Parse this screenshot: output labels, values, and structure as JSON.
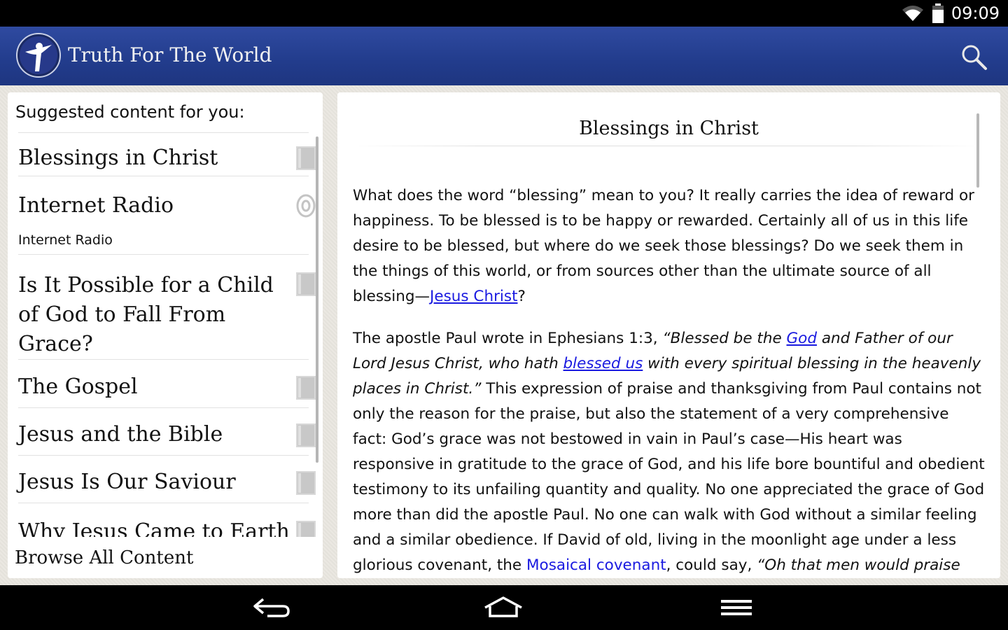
{
  "status_bar": {
    "time": "09:09",
    "icons": [
      "wifi-icon",
      "battery-icon"
    ]
  },
  "app_bar": {
    "title": "Truth For The World",
    "logo": "truth-for-the-world-logo",
    "search_icon": "search-icon",
    "color": "#223c8c"
  },
  "sidebar": {
    "header": "Suggested content for you:",
    "items": [
      {
        "title": "Blessings in Christ",
        "icon": "book-icon"
      },
      {
        "title": "Internet Radio",
        "subtitle": "Internet Radio",
        "icon": "radio-icon"
      },
      {
        "title": "Is It Possible for a Child of God to Fall From Grace?",
        "icon": "book-icon"
      },
      {
        "title": "The Gospel",
        "icon": "book-icon"
      },
      {
        "title": "Jesus and the Bible",
        "icon": "book-icon"
      },
      {
        "title": "Jesus Is Our Saviour",
        "icon": "book-icon"
      },
      {
        "title": "Why Jesus Came to Earth",
        "icon": "book-icon"
      }
    ],
    "browse_all": "Browse All Content"
  },
  "article": {
    "title": "Blessings in Christ",
    "p1": {
      "text": "What does the word “blessing” mean to you? It really carries the idea of reward or happiness. To be blessed is to be happy or rewarded. Certainly all of us in this life desire to be blessed, but where do we seek those blessings? Do we seek them in the things of this world, or from sources other than the ultimate source of all blessing—",
      "link": "Jesus Christ",
      "end": "?"
    },
    "p2": {
      "t1": "The apostle Paul wrote in Ephesians 1:3, ",
      "q1": "“Blessed be the ",
      "link1": "God",
      "q2": " and Father of our Lord Jesus Christ, who hath ",
      "link2": "blessed us",
      "q3": " with every spiritual blessing in the heavenly places in Christ.”",
      "t2": " This expression of praise and thanksgiving from Paul contains not only the reason for the praise, but also the statement of a very comprehensive fact: God’s grace was not bestowed in vain in Paul’s case—His heart was responsive in gratitude to the grace of God, and his life bore bountiful and obedient testimony to its unfailing quantity and quality. No one appreciated the grace of God more than did the apostle Paul. No one can walk with God without a similar feeling and a similar obedience. If David of old, living in the moonlight age under a less glorious covenant, the ",
      "link3": "Mosaical covenant",
      "t3": ", could say, ",
      "q4": "“Oh that men would praise Jehovah for"
    },
    "link_color": "#1a1ae0"
  },
  "nav_bar": {
    "buttons": [
      "back-icon",
      "home-icon",
      "menu-icon"
    ]
  }
}
